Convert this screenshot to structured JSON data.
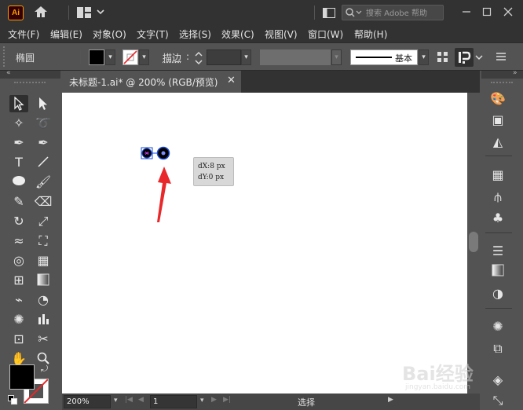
{
  "app": {
    "logo": "Ai"
  },
  "search": {
    "placeholder": "搜索 Adobe 帮助"
  },
  "menu": [
    "文件(F)",
    "编辑(E)",
    "对象(O)",
    "文字(T)",
    "选择(S)",
    "效果(C)",
    "视图(V)",
    "窗口(W)",
    "帮助(H)"
  ],
  "controlbar": {
    "object_label": "椭圆",
    "stroke_label": "描边",
    "stroke_colon": ":",
    "brush_label": "基本",
    "fill_color": "#000000",
    "stroke_color": "none"
  },
  "document": {
    "tab_title": "未标题-1.ai* @ 200% (RGB/预览)",
    "close_glyph": "✕"
  },
  "tooltip": {
    "dx": "dX:8 px",
    "dy": "dY:0 px"
  },
  "status": {
    "zoom": "200%",
    "page": "1",
    "mode": "选择"
  },
  "colors": {
    "chrome_dark": "#323232",
    "chrome": "#535353",
    "canvas": "#ffffff",
    "selection_blue": "#1a4bd6",
    "arrow_red": "#e8282a",
    "accent_orange": "#ff9a00"
  },
  "watermark": {
    "brand": "Bai经验",
    "url": "jingyan.baidu.com"
  },
  "icons": {
    "home": "home-icon",
    "layout": "layout-icon",
    "search": "search-icon",
    "minimize": "minimize-icon",
    "maximize": "maximize-icon",
    "close": "close-icon"
  }
}
